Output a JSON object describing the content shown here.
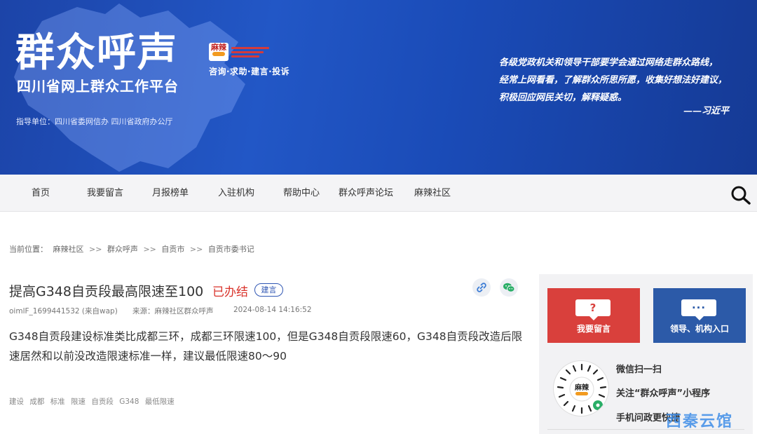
{
  "banner": {
    "title": "群众呼声",
    "subtitle": "四川省网上群众工作平台",
    "logo_text": "麻辣",
    "tags": "咨询·求助·建言·投诉",
    "sponsor": "指导单位：四川省委网信办  四川省政府办公厅",
    "quote_lines": [
      "各级党政机关和领导干部要学会通过网络走群众路线，",
      "经常上网看看，了解群众所思所愿，收集好想法好建议，",
      "积极回应网民关切，解释疑惑。"
    ],
    "quote_author": "——习近平",
    "colors": {
      "bg": "#1f4fbf"
    }
  },
  "nav": {
    "items": [
      "首页",
      "我要留言",
      "月报榜单",
      "入驻机构",
      "帮助中心",
      "群众呼声论坛",
      "麻辣社区"
    ],
    "search_icon": "search-icon"
  },
  "breadcrumb": {
    "label": "当前位置：",
    "items": [
      "麻辣社区",
      "群众呼声",
      "自贡市",
      "自贡市委书记"
    ],
    "sep": ">>"
  },
  "article": {
    "title": "提高G348自贡段最高限速至100",
    "status": "已办结",
    "type": "建言",
    "author": "oimlF_1699441532 (来自wap)",
    "source": "来源：麻辣社区群众呼声",
    "time": "2024-08-14 14:16:52",
    "content": "G348自贡段建设标准类比成都三环，成都三环限速100，但是G348自贡段限速60，G348自贡段改造后限速居然和以前没改造限速标准一样，建议最低限速80～90",
    "keywords": [
      "建设",
      "成都",
      "标准",
      "限速",
      "自贡段",
      "G348",
      "最低限速"
    ],
    "status_color": "#d9322a"
  },
  "sidebar": {
    "btn_message": {
      "icon": "?",
      "label": "我要留言"
    },
    "btn_leaders": {
      "icon": "···",
      "label": "领导、机构入口"
    },
    "qr_logo": "麻辣",
    "scan_text": "微信扫一扫",
    "follow_text": "关注“群众呼声”小程序",
    "mobile_text": "手机问政更快捷"
  },
  "watermark": "西秦云馆"
}
